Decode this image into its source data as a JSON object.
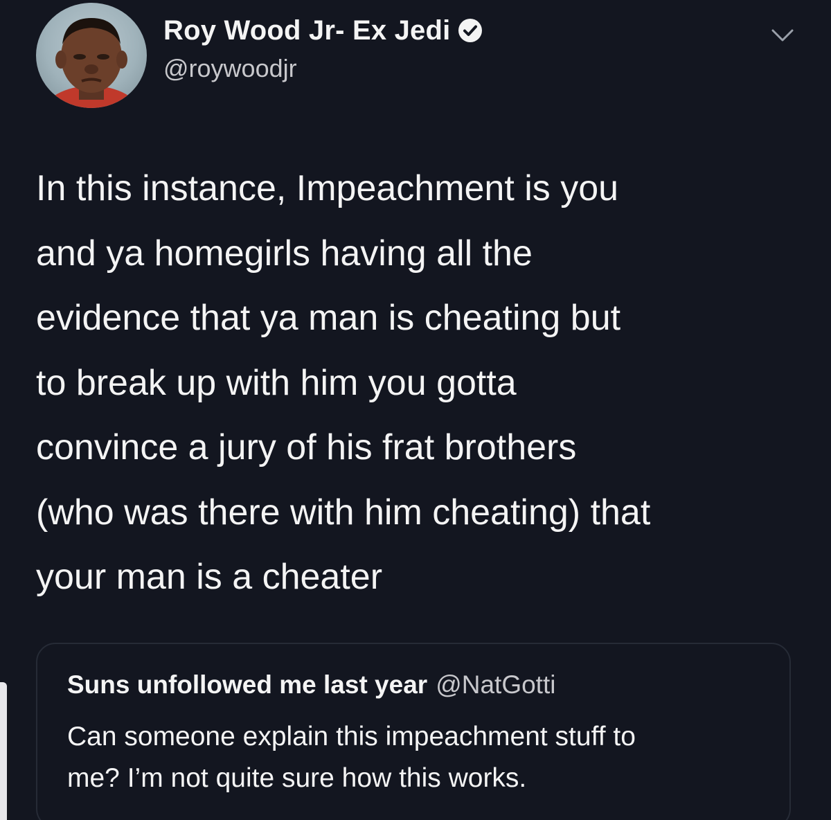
{
  "author": {
    "display_name": "Roy Wood Jr- Ex Jedi",
    "handle": "@roywoodjr",
    "avatar_icon": "profile-photo",
    "verified_icon": "verified-badge-icon"
  },
  "tweet": {
    "lines": [
      "In this instance, Impeachment is you",
      "and ya homegirls having all the",
      "evidence that ya man is cheating but",
      "to break up with him you gotta",
      "convince a jury of his frat brothers",
      "(who was there with him cheating) that",
      "your man is a cheater"
    ]
  },
  "quoted_tweet": {
    "display_name": "Suns unfollowed me last year",
    "handle": "@NatGotti",
    "lines": [
      "Can someone explain this impeachment stuff to",
      "me? I’m not quite sure how this works."
    ]
  },
  "menu_icon": "chevron-down-icon",
  "colors": {
    "background": "#131620",
    "text": "#f4f4f4",
    "secondary_text": "#c8c8cc",
    "card_border": "#262b36"
  }
}
